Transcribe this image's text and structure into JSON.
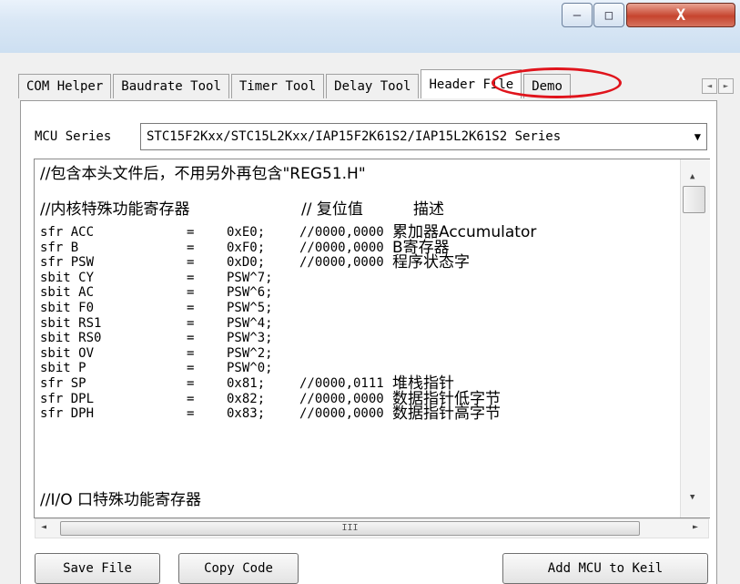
{
  "window": {
    "minimize_glyph": "—",
    "maximize_glyph": "□",
    "close_glyph": "X"
  },
  "tabs": [
    {
      "label": "COM Helper"
    },
    {
      "label": "Baudrate Tool"
    },
    {
      "label": "Timer Tool"
    },
    {
      "label": "Delay Tool"
    },
    {
      "label": "Header File",
      "active": true
    },
    {
      "label": "Demo"
    }
  ],
  "tab_scroll": {
    "left_glyph": "◄",
    "right_glyph": "►"
  },
  "mcu": {
    "label": "MCU Series",
    "selected": "STC15F2Kxx/STC15L2Kxx/IAP15F2K61S2/IAP15L2K61S2 Series"
  },
  "code": {
    "line_include": "//包含本头文件后，不用另外再包含\"REG51.H\"",
    "section_core": "//内核特殊功能寄存器",
    "col_reset": "// 复位值",
    "col_desc": "描述",
    "rows": [
      {
        "name": "sfr ACC",
        "value": "0xE0;",
        "reset": "//0000,0000",
        "desc": "累加器Accumulator"
      },
      {
        "name": "sfr B",
        "value": "0xF0;",
        "reset": "//0000,0000",
        "desc": "B寄存器"
      },
      {
        "name": "sfr PSW",
        "value": "0xD0;",
        "reset": "//0000,0000",
        "desc": "程序状态字"
      },
      {
        "name": "sbit CY",
        "value": "PSW^7;",
        "reset": "",
        "desc": ""
      },
      {
        "name": "sbit AC",
        "value": "PSW^6;",
        "reset": "",
        "desc": ""
      },
      {
        "name": "sbit F0",
        "value": "PSW^5;",
        "reset": "",
        "desc": ""
      },
      {
        "name": "sbit RS1",
        "value": "PSW^4;",
        "reset": "",
        "desc": ""
      },
      {
        "name": "sbit RS0",
        "value": "PSW^3;",
        "reset": "",
        "desc": ""
      },
      {
        "name": "sbit OV",
        "value": "PSW^2;",
        "reset": "",
        "desc": ""
      },
      {
        "name": "sbit P",
        "value": "PSW^0;",
        "reset": "",
        "desc": ""
      },
      {
        "name": "sfr SP",
        "value": "0x81;",
        "reset": "//0000,0111",
        "desc": "堆栈指针"
      },
      {
        "name": "sfr DPL",
        "value": "0x82;",
        "reset": "//0000,0000",
        "desc": "数据指针低字节"
      },
      {
        "name": "sfr DPH",
        "value": "0x83;",
        "reset": "//0000,0000",
        "desc": "数据指针高字节"
      }
    ],
    "equals": "=",
    "section_io": "//I/O 口特殊功能寄存器"
  },
  "scroll": {
    "up": "▲",
    "down": "▼",
    "left": "◄",
    "right": "►",
    "grip": "III"
  },
  "buttons": {
    "save": "Save File",
    "copy": "Copy Code",
    "add": "Add MCU to Keil"
  }
}
